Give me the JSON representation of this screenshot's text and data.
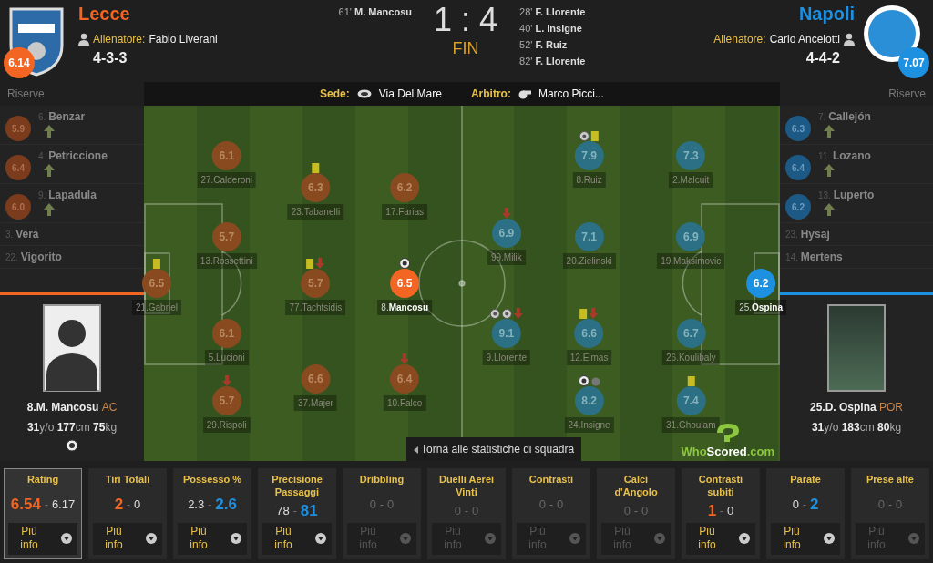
{
  "home": {
    "name": "Lecce",
    "rating": "6.14",
    "coach_label": "Allenatore:",
    "coach": "Fabio Liverani",
    "formation": "4-3-3",
    "scorers": [
      {
        "minute": "61'",
        "name": "M. Mancosu"
      }
    ]
  },
  "score": "1 : 4",
  "status": "FIN",
  "away": {
    "name": "Napoli",
    "rating": "7.07",
    "coach_label": "Allenatore:",
    "coach": "Carlo Ancelotti",
    "formation": "4-4-2",
    "scorers": [
      {
        "minute": "28'",
        "name": "F. Llorente"
      },
      {
        "minute": "40'",
        "name": "L. Insigne"
      },
      {
        "minute": "52'",
        "name": "F. Ruiz"
      },
      {
        "minute": "82'",
        "name": "F. Llorente"
      }
    ]
  },
  "match_bar": {
    "reserves_home": "Riserve",
    "venue_label": "Sede:",
    "venue": "Via Del Mare",
    "referee_label": "Arbitro:",
    "referee": "Marco Picci...",
    "reserves_away": "Riserve"
  },
  "home_reserves": [
    {
      "number": "6.",
      "name": "Benzar",
      "rating": "5.9",
      "subbed_on": true
    },
    {
      "number": "4.",
      "name": "Petriccione",
      "rating": "6.4",
      "subbed_on": true
    },
    {
      "number": "9.",
      "name": "Lapadula",
      "rating": "6.0",
      "subbed_on": true
    },
    {
      "number": "3.",
      "name": "Vera",
      "subbed_on": false
    },
    {
      "number": "22.",
      "name": "Vigorito",
      "subbed_on": false
    }
  ],
  "away_reserves": [
    {
      "number": "7.",
      "name": "Callejón",
      "rating": "6.3",
      "subbed_on": true
    },
    {
      "number": "11.",
      "name": "Lozano",
      "rating": "6.4",
      "subbed_on": true
    },
    {
      "number": "13.",
      "name": "Luperto",
      "rating": "6.2",
      "subbed_on": true
    },
    {
      "number": "23.",
      "name": "Hysaj",
      "subbed_on": false
    },
    {
      "number": "14.",
      "name": "Mertens",
      "subbed_on": false
    }
  ],
  "home_player_card": {
    "name": "8.M. Mancosu",
    "position": "AC",
    "stats": "**31**y/o **177**cm **75**kg",
    "photo": {
      "kind": "silhouette"
    },
    "badges": [
      {
        "kind": "badge"
      }
    ]
  },
  "away_player_card": {
    "name": "25.D. Ospina",
    "position": "POR",
    "stats": "**31**y/o **183**cm **80**kg",
    "photo": {
      "kind": "photo"
    }
  },
  "home_lines": [
    [
      {
        "number": "21.",
        "name": "Gabriel",
        "rating": "6.5",
        "selected": false,
        "events": [
          {
            "kind": "card"
          }
        ]
      }
    ],
    [
      {
        "number": "27.",
        "name": "Calderoni",
        "rating": "6.1",
        "selected": false
      },
      {
        "number": "13.",
        "name": "Rossettini",
        "rating": "5.7",
        "selected": false
      },
      {
        "number": "5.",
        "name": "Lucioni",
        "rating": "6.1",
        "selected": false
      },
      {
        "number": "29.",
        "name": "Rispoli",
        "rating": "5.7",
        "selected": false,
        "events": [
          {
            "kind": "sub_off"
          }
        ]
      }
    ],
    [
      {
        "number": "23.",
        "name": "Tabanelli",
        "rating": "6.3",
        "selected": false,
        "events": [
          {
            "kind": "card"
          }
        ]
      },
      {
        "number": "77.",
        "name": "Tachtsidis",
        "rating": "5.7",
        "selected": false,
        "events": [
          {
            "kind": "card"
          },
          {
            "kind": "sub_off"
          }
        ]
      },
      {
        "number": "37.",
        "name": "Majer",
        "rating": "6.6",
        "selected": false
      }
    ],
    [
      {
        "number": "17.",
        "name": "Farias",
        "rating": "6.2",
        "selected": false
      },
      {
        "number": "8.",
        "name": "Mancosu",
        "rating": "6.5",
        "selected": true,
        "events": [
          {
            "kind": "badge"
          }
        ]
      },
      {
        "number": "10.",
        "name": "Falco",
        "rating": "6.4",
        "selected": false,
        "events": [
          {
            "kind": "sub_off"
          }
        ]
      }
    ]
  ],
  "away_lines": [
    [
      {
        "number": "99.",
        "name": "Milik",
        "rating": "6.9",
        "selected": false,
        "events": [
          {
            "kind": "sub_off"
          }
        ]
      },
      {
        "number": "9.",
        "name": "Llorente",
        "rating": "9.1",
        "selected": false,
        "events": [
          {
            "kind": "goal"
          },
          {
            "kind": "goal"
          },
          {
            "kind": "sub_off"
          }
        ]
      }
    ],
    [
      {
        "number": "8.",
        "name": "Ruiz",
        "rating": "7.9",
        "selected": false,
        "events": [
          {
            "kind": "goal"
          },
          {
            "kind": "card"
          }
        ]
      },
      {
        "number": "20.",
        "name": "Zielinski",
        "rating": "7.1",
        "selected": false
      },
      {
        "number": "12.",
        "name": "Elmas",
        "rating": "6.6",
        "selected": false,
        "events": [
          {
            "kind": "card"
          },
          {
            "kind": "sub_off"
          }
        ]
      },
      {
        "number": "24.",
        "name": "Insigne",
        "rating": "8.2",
        "selected": false,
        "events": [
          {
            "kind": "badge"
          },
          {
            "kind": "assist"
          }
        ]
      }
    ],
    [
      {
        "number": "2.",
        "name": "Malcuit",
        "rating": "7.3",
        "selected": false
      },
      {
        "number": "19.",
        "name": "Maksimovic",
        "rating": "6.9",
        "selected": false
      },
      {
        "number": "26.",
        "name": "Koulibaly",
        "rating": "6.7",
        "selected": false
      },
      {
        "number": "31.",
        "name": "Ghoulam",
        "rating": "7.4",
        "selected": false,
        "events": [
          {
            "kind": "card"
          }
        ]
      }
    ],
    [
      {
        "number": "25.",
        "name": "Ospina",
        "rating": "6.2",
        "selected": true
      }
    ]
  ],
  "back_button": "Torna alle statistiche di squadra",
  "brand": {
    "first": "Who",
    "second": "Scored",
    "third": ".com"
  },
  "stats": [
    {
      "title": "Rating",
      "home": "6.54",
      "separator": "-",
      "away": "6.17",
      "home_lead": true,
      "away_lead": false,
      "selected": true,
      "disabled": false,
      "more": "Più info"
    },
    {
      "title": "Tiri Totali",
      "home": "2",
      "separator": "-",
      "away": "0",
      "home_lead": true,
      "away_lead": false,
      "selected": false,
      "disabled": false,
      "more": "Più info"
    },
    {
      "title": "Possesso %",
      "home": "2.3",
      "separator": "-",
      "away": "2.6",
      "home_lead": false,
      "away_lead": true,
      "selected": false,
      "disabled": false,
      "more": "Più info"
    },
    {
      "title": "Precisione Passaggi",
      "home": "78",
      "separator": "-",
      "away": "81",
      "home_lead": false,
      "away_lead": true,
      "selected": false,
      "disabled": false,
      "more": "Più info"
    },
    {
      "title": "Dribbling",
      "home": "0",
      "separator": "-",
      "away": "0",
      "selected": false,
      "disabled": true,
      "more": "Più info"
    },
    {
      "title": "Duelli Aerei Vinti",
      "home": "0",
      "separator": "-",
      "away": "0",
      "selected": false,
      "disabled": true,
      "more": "Più info"
    },
    {
      "title": "Contrasti",
      "home": "0",
      "separator": "-",
      "away": "0",
      "selected": false,
      "disabled": true,
      "more": "Più info"
    },
    {
      "title": "Calci d'Angolo",
      "home": "0",
      "separator": "-",
      "away": "0",
      "selected": false,
      "disabled": true,
      "more": "Più info"
    },
    {
      "title": "Contrasti subiti",
      "home": "1",
      "separator": "-",
      "away": "0",
      "home_lead": true,
      "away_lead": false,
      "selected": false,
      "disabled": false,
      "more": "Più info"
    },
    {
      "title": "Parate",
      "home": "0",
      "separator": "-",
      "away": "2",
      "home_lead": false,
      "away_lead": true,
      "selected": false,
      "disabled": false,
      "more": "Più info"
    },
    {
      "title": "Prese alte",
      "home": "0",
      "separator": "-",
      "away": "0",
      "selected": false,
      "disabled": true,
      "more": "Più info"
    }
  ]
}
